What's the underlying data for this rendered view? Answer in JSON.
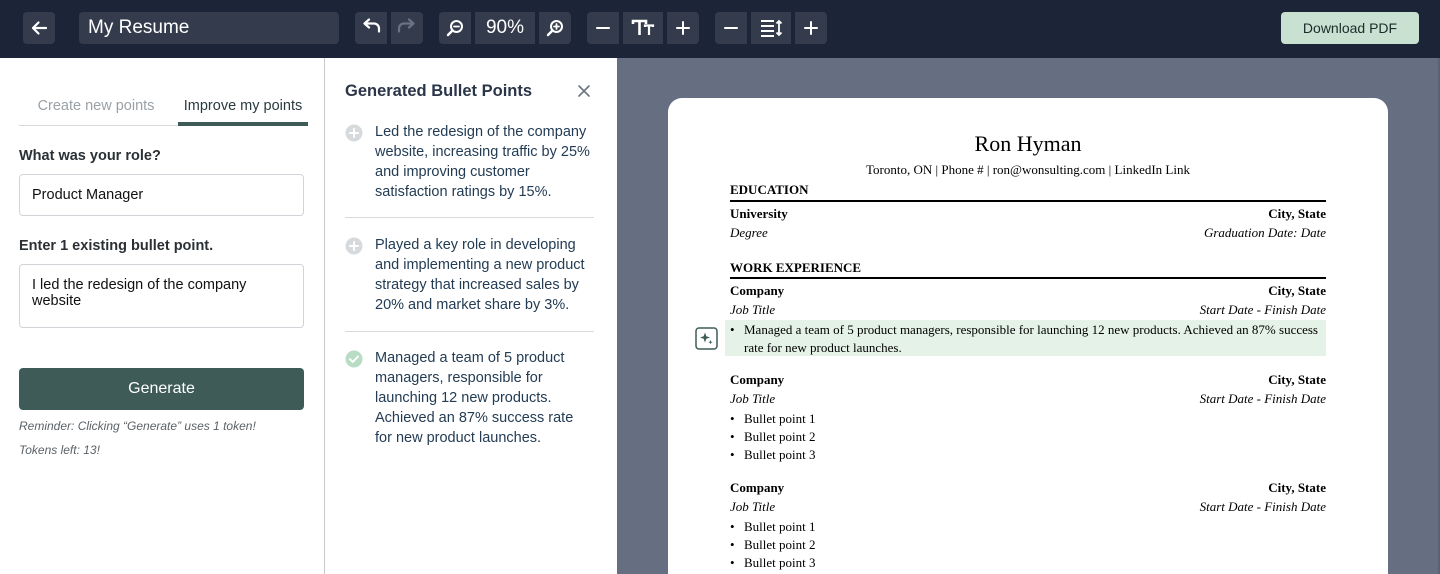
{
  "toolbar": {
    "document_title": "My Resume",
    "zoom": "90%",
    "download_label": "Download PDF"
  },
  "icons": {
    "back": "arrow-left-icon",
    "undo": "undo-icon",
    "redo": "redo-icon",
    "zoom_out": "zoom-out-icon",
    "zoom_in": "zoom-in-icon",
    "font_size": "text-size-icon",
    "line_spacing": "line-spacing-icon",
    "close": "close-icon",
    "add": "plus-circle-icon",
    "selected": "check-circle-icon",
    "ai": "sparkle-icon"
  },
  "colors": {
    "topbar": "#1c2437",
    "accent": "#3e5b57",
    "download_bg": "#c8e1d0",
    "highlight": "#e5f2e8"
  },
  "left_panel": {
    "tabs": [
      {
        "label": "Create new points",
        "active": false
      },
      {
        "label": "Improve my points",
        "active": true
      }
    ],
    "role_label": "What was your role?",
    "role_value": "Product Manager",
    "bullet_label": "Enter 1 existing bullet point.",
    "bullet_value": "I led the redesign of the company website",
    "generate_label": "Generate",
    "reminder": "Reminder: Clicking “Generate” uses 1 token!",
    "tokens_left": "Tokens left: 13!"
  },
  "suggestions": {
    "title": "Generated Bullet Points",
    "items": [
      {
        "text": "Led the redesign of the company website, increasing traffic by 25% and improving customer satisfaction ratings by 15%.",
        "state": "add"
      },
      {
        "text": "Played a key role in developing and implementing a new product strategy that increased sales by 20% and market share by 3%.",
        "state": "add"
      },
      {
        "text": "Managed a team of 5 product managers, responsible for launching 12 new products. Achieved an 87% success rate for new product launches.",
        "state": "selected"
      }
    ]
  },
  "resume": {
    "name": "Ron Hyman",
    "contact": "Toronto, ON | Phone # | ron@wonsulting.com | LinkedIn Link",
    "education_heading": "EDUCATION",
    "university": "University",
    "edu_location": "City, State",
    "degree": "Degree",
    "graduation": "Graduation Date: Date",
    "work_heading": "WORK EXPERIENCE",
    "jobs": [
      {
        "company": "Company",
        "location": "City, State",
        "title": "Job Title",
        "dates": "Start Date - Finish Date",
        "bullets": [
          "Managed a team of 5 product managers, responsible for launching 12 new products. Achieved an 87% success rate for new product launches."
        ]
      },
      {
        "company": "Company",
        "location": "City, State",
        "title": "Job Title",
        "dates": "Start Date - Finish Date",
        "bullets": [
          "Bullet point 1",
          "Bullet point 2",
          "Bullet point 3"
        ]
      },
      {
        "company": "Company",
        "location": "City, State",
        "title": "Job Title",
        "dates": "Start Date - Finish Date",
        "bullets": [
          "Bullet point 1",
          "Bullet point 2",
          "Bullet point 3"
        ]
      }
    ]
  }
}
